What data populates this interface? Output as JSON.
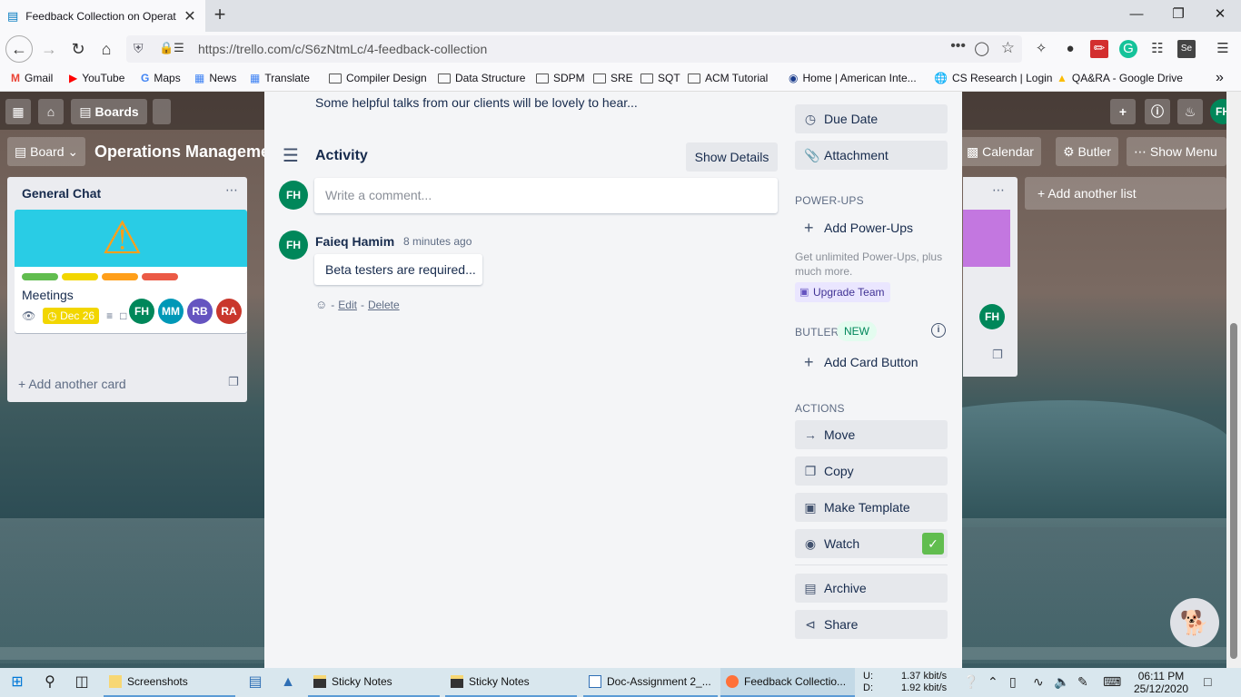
{
  "browser": {
    "tab_title": "Feedback Collection on Operat",
    "url": "https://trello.com/c/S6zNtmLc/4-feedback-collection",
    "bookmarks": [
      "Gmail",
      "YouTube",
      "Maps",
      "News",
      "Translate",
      "Compiler Design",
      "Data Structure",
      "SDPM",
      "SRE",
      "SQT",
      "ACM Tutorial",
      "Home | American Inte...",
      "CS Research | Login",
      "QA&RA - Google Drive"
    ]
  },
  "board": {
    "boards_label": "Boards",
    "board_label": "Board",
    "title": "Operations Manageme",
    "calendar_label": "Calendar",
    "butler_label": "Butler",
    "show_menu_label": "Show Menu",
    "user_initials": "FH",
    "add_list_label": "Add another list",
    "list": {
      "title": "General Chat",
      "card_title": "Meetings",
      "due": "Dec 26",
      "comments": "1",
      "members": [
        "FH",
        "MM",
        "RB",
        "RA"
      ],
      "add_card_label": "Add another card"
    },
    "right_member": "FH",
    "label_colors": [
      "#61bd4f",
      "#f2d600",
      "#ff9f1a",
      "#eb5a46"
    ]
  },
  "modal": {
    "description_text": "Some helpful talks from our clients will be lovely to hear...",
    "activity_title": "Activity",
    "show_details_label": "Show Details",
    "user_initials": "FH",
    "comment_placeholder": "Write a comment...",
    "comment": {
      "author_initials": "FH",
      "author": "Faieq Hamim",
      "time": "8 minutes ago",
      "body": "Beta testers are required...",
      "edit_label": "Edit",
      "delete_label": "Delete",
      "separator": "-"
    },
    "sidebar": {
      "due_date_label": "Due Date",
      "attachment_label": "Attachment",
      "powerups_heading": "POWER-UPS",
      "add_powerups_label": "Add Power-Ups",
      "upsell_text": "Get unlimited Power-Ups, plus much more.",
      "upgrade_label": "Upgrade Team",
      "butler_heading": "BUTLER",
      "new_badge": "NEW",
      "add_card_button_label": "Add Card Button",
      "actions_heading": "ACTIONS",
      "move_label": "Move",
      "copy_label": "Copy",
      "make_template_label": "Make Template",
      "watch_label": "Watch",
      "archive_label": "Archive",
      "share_label": "Share"
    }
  },
  "taskbar": {
    "items": [
      "Screenshots",
      "Sticky Notes",
      "Sticky Notes",
      "Doc-Assignment 2_...",
      "Feedback Collectio..."
    ],
    "net_up_label": "U:",
    "net_down_label": "D:",
    "net_up": "1.37 kbit/s",
    "net_down": "1.92 kbit/s",
    "time": "06:11 PM",
    "date": "25/12/2020"
  }
}
